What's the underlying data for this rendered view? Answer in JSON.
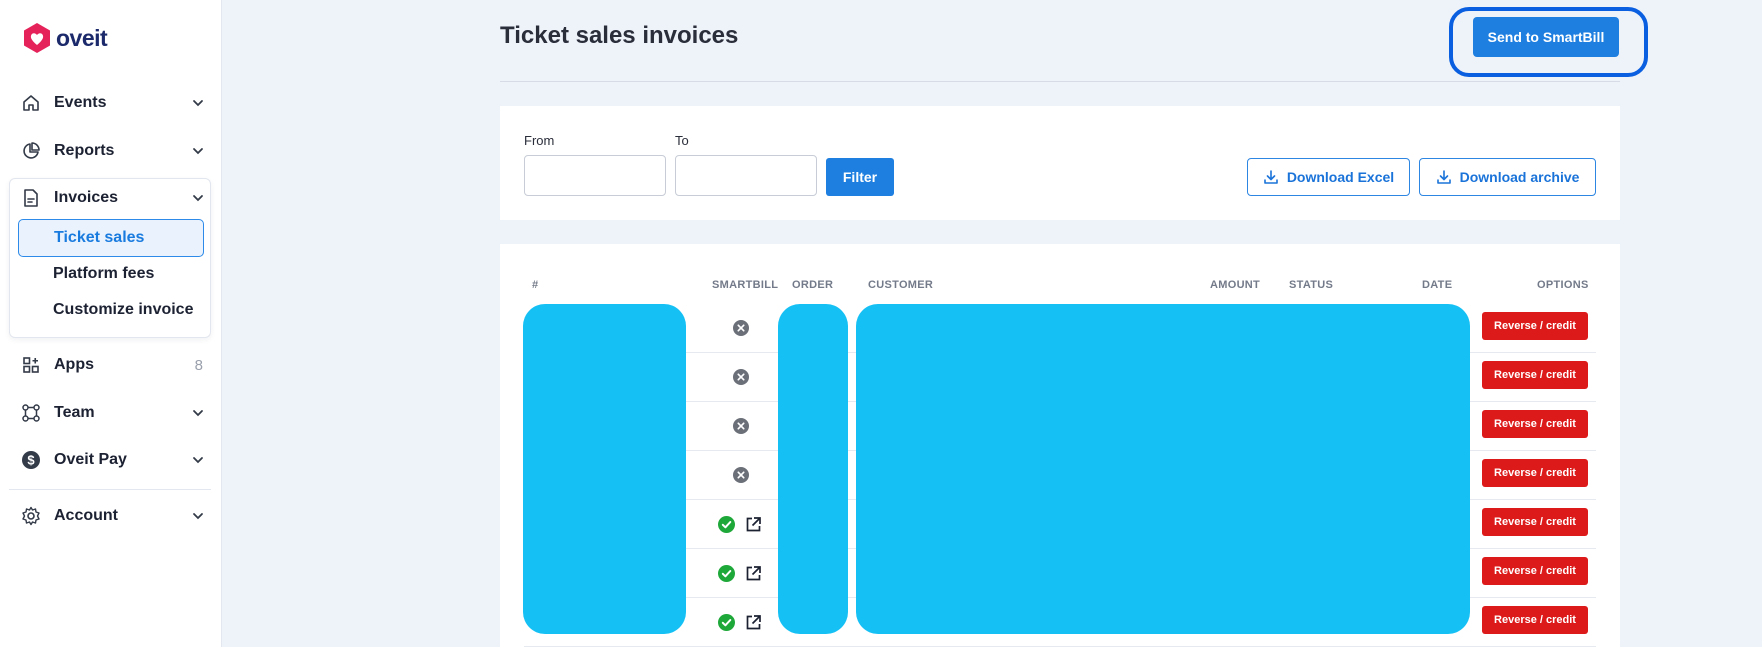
{
  "app": {
    "logo_text": "oveit"
  },
  "sidebar": {
    "events": {
      "label": "Events",
      "icon": "home-icon"
    },
    "reports": {
      "label": "Reports",
      "icon": "pie-chart-icon"
    },
    "invoices": {
      "label": "Invoices",
      "icon": "document-icon",
      "items": [
        {
          "label": "Ticket sales",
          "active": true
        },
        {
          "label": "Platform fees",
          "active": false
        },
        {
          "label": "Customize invoice",
          "active": false
        }
      ]
    },
    "apps": {
      "label": "Apps",
      "count": "8",
      "icon": "grid-plus-icon"
    },
    "team": {
      "label": "Team",
      "icon": "team-nodes-icon"
    },
    "oveit_pay": {
      "label": "Oveit Pay",
      "icon": "dollar-circle-icon"
    },
    "account": {
      "label": "Account",
      "icon": "gear-icon"
    }
  },
  "header": {
    "title": "Ticket sales invoices",
    "smartbill_button": "Send to SmartBill"
  },
  "filters": {
    "from_label": "From",
    "to_label": "To",
    "from_value": "",
    "to_value": "",
    "filter_button": "Filter",
    "download_excel": "Download Excel",
    "download_archive": "Download archive"
  },
  "table": {
    "columns": {
      "number": "#",
      "smartbill": "SMARTBILL",
      "order": "ORDER",
      "customer": "CUSTOMER",
      "amount": "AMOUNT",
      "status": "STATUS",
      "date": "DATE",
      "options": "OPTIONS"
    },
    "row_action": "Reverse / credit",
    "rows": [
      {
        "smartbill_status": "not-sent",
        "has_link": false
      },
      {
        "smartbill_status": "not-sent",
        "has_link": false
      },
      {
        "smartbill_status": "not-sent",
        "has_link": false
      },
      {
        "smartbill_status": "not-sent",
        "has_link": false
      },
      {
        "smartbill_status": "sent",
        "has_link": true
      },
      {
        "smartbill_status": "sent",
        "has_link": true
      },
      {
        "smartbill_status": "sent",
        "has_link": true
      }
    ]
  },
  "colors": {
    "accent": "#1e7fe0",
    "danger": "#dd1a1a",
    "success": "#1fa83a",
    "redaction": "#15c0f5",
    "highlight": "#0a5fe0"
  }
}
